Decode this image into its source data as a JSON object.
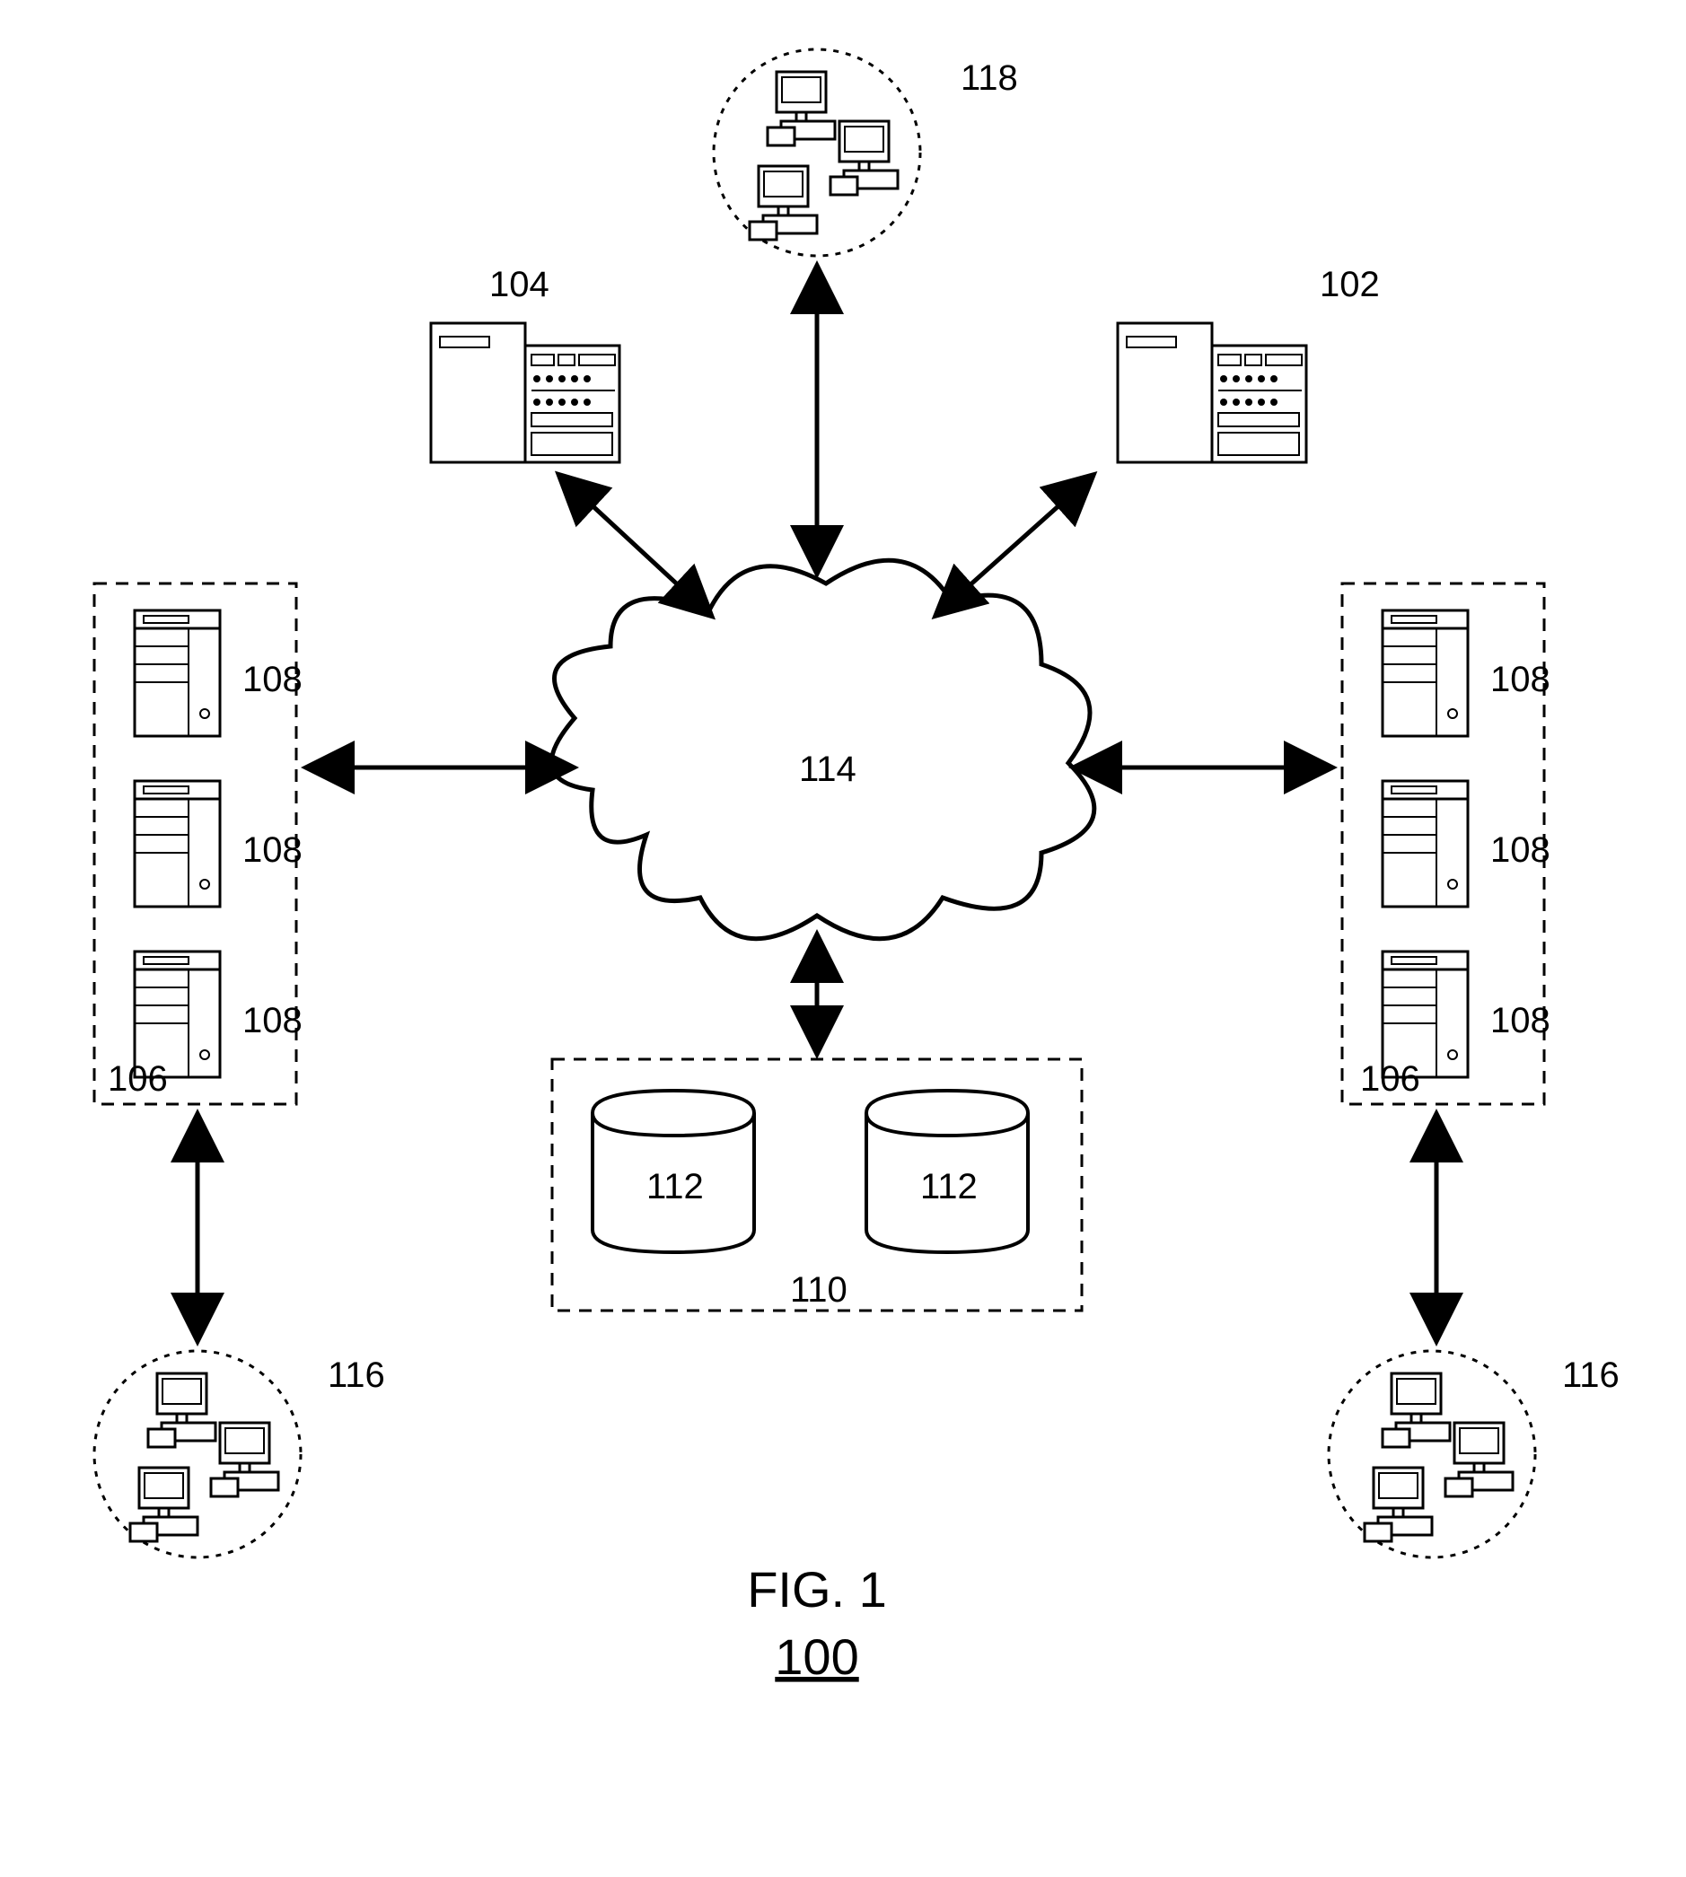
{
  "figure": {
    "caption_line1": "FIG. 1",
    "caption_line2": "100"
  },
  "labels": {
    "cloud": "114",
    "server_top_left": "104",
    "server_top_right": "102",
    "client_cluster_top": "118",
    "client_cluster_left": "116",
    "client_cluster_right": "116",
    "server_group_left": "106",
    "server_group_right": "106",
    "server_item": "108",
    "storage_group": "110",
    "storage_item": "112"
  },
  "diagram_structure": {
    "central_node": {
      "ref": "114",
      "type": "network-cloud"
    },
    "nodes_connected_to_cloud": [
      {
        "ref": "104",
        "type": "mainframe-server",
        "position": "upper-left"
      },
      {
        "ref": "102",
        "type": "mainframe-server",
        "position": "upper-right"
      },
      {
        "ref": "118",
        "type": "client-computer-cluster",
        "position": "top"
      },
      {
        "ref": "106",
        "type": "server-farm",
        "position": "left",
        "contains": [
          {
            "ref": "108"
          },
          {
            "ref": "108"
          },
          {
            "ref": "108"
          }
        ]
      },
      {
        "ref": "106",
        "type": "server-farm",
        "position": "right",
        "contains": [
          {
            "ref": "108"
          },
          {
            "ref": "108"
          },
          {
            "ref": "108"
          }
        ]
      },
      {
        "ref": "110",
        "type": "storage-pool",
        "position": "bottom",
        "contains": [
          {
            "ref": "112"
          },
          {
            "ref": "112"
          }
        ]
      }
    ],
    "secondary_edges": [
      {
        "from": "106-left",
        "to": "116-left"
      },
      {
        "from": "106-right",
        "to": "116-right"
      }
    ]
  }
}
